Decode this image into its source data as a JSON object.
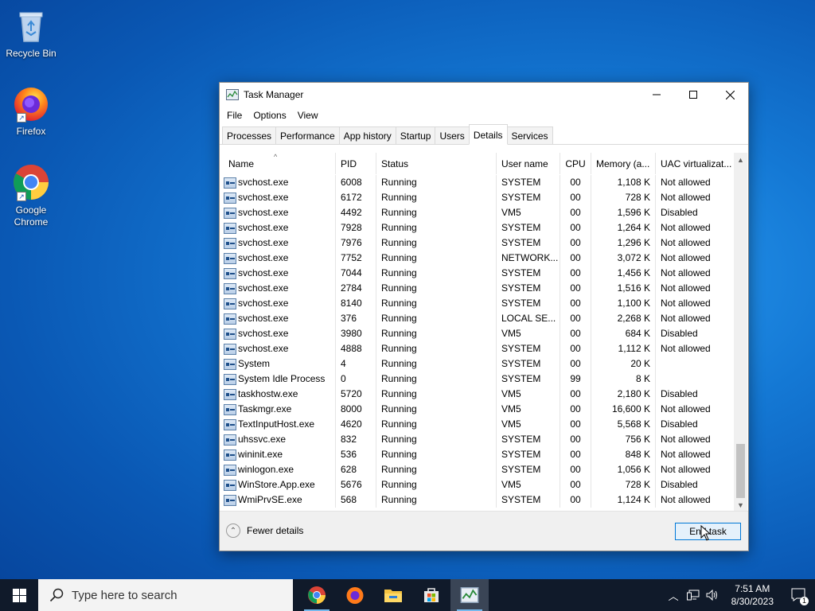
{
  "desktop": {
    "icons": [
      {
        "label": "Recycle Bin"
      },
      {
        "label": "Firefox"
      },
      {
        "label": "Google Chrome"
      }
    ]
  },
  "window": {
    "title": "Task Manager",
    "menu": [
      "File",
      "Options",
      "View"
    ],
    "tabs": [
      "Processes",
      "Performance",
      "App history",
      "Startup",
      "Users",
      "Details",
      "Services"
    ],
    "active_tab": "Details",
    "columns": [
      "Name",
      "PID",
      "Status",
      "User name",
      "CPU",
      "Memory (a...",
      "UAC virtualizat..."
    ],
    "rows": [
      {
        "name": "svchost.exe",
        "pid": "6008",
        "status": "Running",
        "user": "SYSTEM",
        "cpu": "00",
        "mem": "1,108 K",
        "uac": "Not allowed"
      },
      {
        "name": "svchost.exe",
        "pid": "6172",
        "status": "Running",
        "user": "SYSTEM",
        "cpu": "00",
        "mem": "728 K",
        "uac": "Not allowed"
      },
      {
        "name": "svchost.exe",
        "pid": "4492",
        "status": "Running",
        "user": "VM5",
        "cpu": "00",
        "mem": "1,596 K",
        "uac": "Disabled"
      },
      {
        "name": "svchost.exe",
        "pid": "7928",
        "status": "Running",
        "user": "SYSTEM",
        "cpu": "00",
        "mem": "1,264 K",
        "uac": "Not allowed"
      },
      {
        "name": "svchost.exe",
        "pid": "7976",
        "status": "Running",
        "user": "SYSTEM",
        "cpu": "00",
        "mem": "1,296 K",
        "uac": "Not allowed"
      },
      {
        "name": "svchost.exe",
        "pid": "7752",
        "status": "Running",
        "user": "NETWORK...",
        "cpu": "00",
        "mem": "3,072 K",
        "uac": "Not allowed"
      },
      {
        "name": "svchost.exe",
        "pid": "7044",
        "status": "Running",
        "user": "SYSTEM",
        "cpu": "00",
        "mem": "1,456 K",
        "uac": "Not allowed"
      },
      {
        "name": "svchost.exe",
        "pid": "2784",
        "status": "Running",
        "user": "SYSTEM",
        "cpu": "00",
        "mem": "1,516 K",
        "uac": "Not allowed"
      },
      {
        "name": "svchost.exe",
        "pid": "8140",
        "status": "Running",
        "user": "SYSTEM",
        "cpu": "00",
        "mem": "1,100 K",
        "uac": "Not allowed"
      },
      {
        "name": "svchost.exe",
        "pid": "376",
        "status": "Running",
        "user": "LOCAL SE...",
        "cpu": "00",
        "mem": "2,268 K",
        "uac": "Not allowed"
      },
      {
        "name": "svchost.exe",
        "pid": "3980",
        "status": "Running",
        "user": "VM5",
        "cpu": "00",
        "mem": "684 K",
        "uac": "Disabled"
      },
      {
        "name": "svchost.exe",
        "pid": "4888",
        "status": "Running",
        "user": "SYSTEM",
        "cpu": "00",
        "mem": "1,112 K",
        "uac": "Not allowed"
      },
      {
        "name": "System",
        "pid": "4",
        "status": "Running",
        "user": "SYSTEM",
        "cpu": "00",
        "mem": "20 K",
        "uac": ""
      },
      {
        "name": "System Idle Process",
        "pid": "0",
        "status": "Running",
        "user": "SYSTEM",
        "cpu": "99",
        "mem": "8 K",
        "uac": ""
      },
      {
        "name": "taskhostw.exe",
        "pid": "5720",
        "status": "Running",
        "user": "VM5",
        "cpu": "00",
        "mem": "2,180 K",
        "uac": "Disabled"
      },
      {
        "name": "Taskmgr.exe",
        "pid": "8000",
        "status": "Running",
        "user": "VM5",
        "cpu": "00",
        "mem": "16,600 K",
        "uac": "Not allowed"
      },
      {
        "name": "TextInputHost.exe",
        "pid": "4620",
        "status": "Running",
        "user": "VM5",
        "cpu": "00",
        "mem": "5,568 K",
        "uac": "Disabled"
      },
      {
        "name": "uhssvc.exe",
        "pid": "832",
        "status": "Running",
        "user": "SYSTEM",
        "cpu": "00",
        "mem": "756 K",
        "uac": "Not allowed"
      },
      {
        "name": "wininit.exe",
        "pid": "536",
        "status": "Running",
        "user": "SYSTEM",
        "cpu": "00",
        "mem": "848 K",
        "uac": "Not allowed"
      },
      {
        "name": "winlogon.exe",
        "pid": "628",
        "status": "Running",
        "user": "SYSTEM",
        "cpu": "00",
        "mem": "1,056 K",
        "uac": "Not allowed"
      },
      {
        "name": "WinStore.App.exe",
        "pid": "5676",
        "status": "Running",
        "user": "VM5",
        "cpu": "00",
        "mem": "728 K",
        "uac": "Disabled"
      },
      {
        "name": "WmiPrvSE.exe",
        "pid": "568",
        "status": "Running",
        "user": "SYSTEM",
        "cpu": "00",
        "mem": "1,124 K",
        "uac": "Not allowed"
      }
    ],
    "fewer_details": "Fewer details",
    "end_task": "End task"
  },
  "taskbar": {
    "search_placeholder": "Type here to search",
    "time": "7:51 AM",
    "date": "8/30/2023",
    "notification_count": "1"
  }
}
